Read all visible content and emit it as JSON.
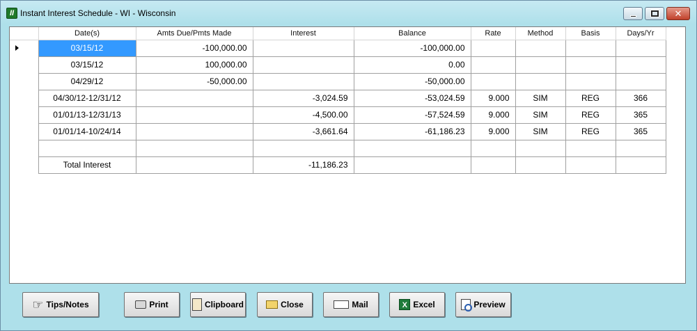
{
  "window": {
    "title": "Instant Interest Schedule - WI  - Wisconsin",
    "app_icon_letter": "II",
    "close_glyph": "✕"
  },
  "grid": {
    "columns": [
      "Date(s)",
      "Amts Due/Pmts Made",
      "Interest",
      "Balance",
      "Rate",
      "Method",
      "Basis",
      "Days/Yr"
    ],
    "rows": [
      {
        "date": "03/15/12",
        "amount": "-100,000.00",
        "interest": "",
        "balance": "-100,000.00",
        "rate": "",
        "method": "",
        "basis": "",
        "days": ""
      },
      {
        "date": "03/15/12",
        "amount": "100,000.00",
        "interest": "",
        "balance": "0.00",
        "rate": "",
        "method": "",
        "basis": "",
        "days": ""
      },
      {
        "date": "04/29/12",
        "amount": "-50,000.00",
        "interest": "",
        "balance": "-50,000.00",
        "rate": "",
        "method": "",
        "basis": "",
        "days": ""
      },
      {
        "date": "04/30/12-12/31/12",
        "amount": "",
        "interest": "-3,024.59",
        "balance": "-53,024.59",
        "rate": "9.000",
        "method": "SIM",
        "basis": "REG",
        "days": "366"
      },
      {
        "date": "01/01/13-12/31/13",
        "amount": "",
        "interest": "-4,500.00",
        "balance": "-57,524.59",
        "rate": "9.000",
        "method": "SIM",
        "basis": "REG",
        "days": "365"
      },
      {
        "date": "01/01/14-10/24/14",
        "amount": "",
        "interest": "-3,661.64",
        "balance": "-61,186.23",
        "rate": "9.000",
        "method": "SIM",
        "basis": "REG",
        "days": "365"
      },
      {
        "date": "",
        "amount": "",
        "interest": "",
        "balance": "",
        "rate": "",
        "method": "",
        "basis": "",
        "days": ""
      },
      {
        "date": "Total Interest",
        "amount": "",
        "interest": "-11,186.23",
        "balance": "",
        "rate": "",
        "method": "",
        "basis": "",
        "days": ""
      }
    ]
  },
  "buttons": {
    "tips": "Tips/Notes",
    "print": "Print",
    "clipboard": "Clipboard",
    "close": "Close",
    "mail": "Mail",
    "excel": "Excel",
    "preview": "Preview"
  },
  "icons": {
    "hand": "☞",
    "excel_letter": "X"
  },
  "colors": {
    "window_bg": "#aee0ea",
    "selection": "#3399ff"
  }
}
